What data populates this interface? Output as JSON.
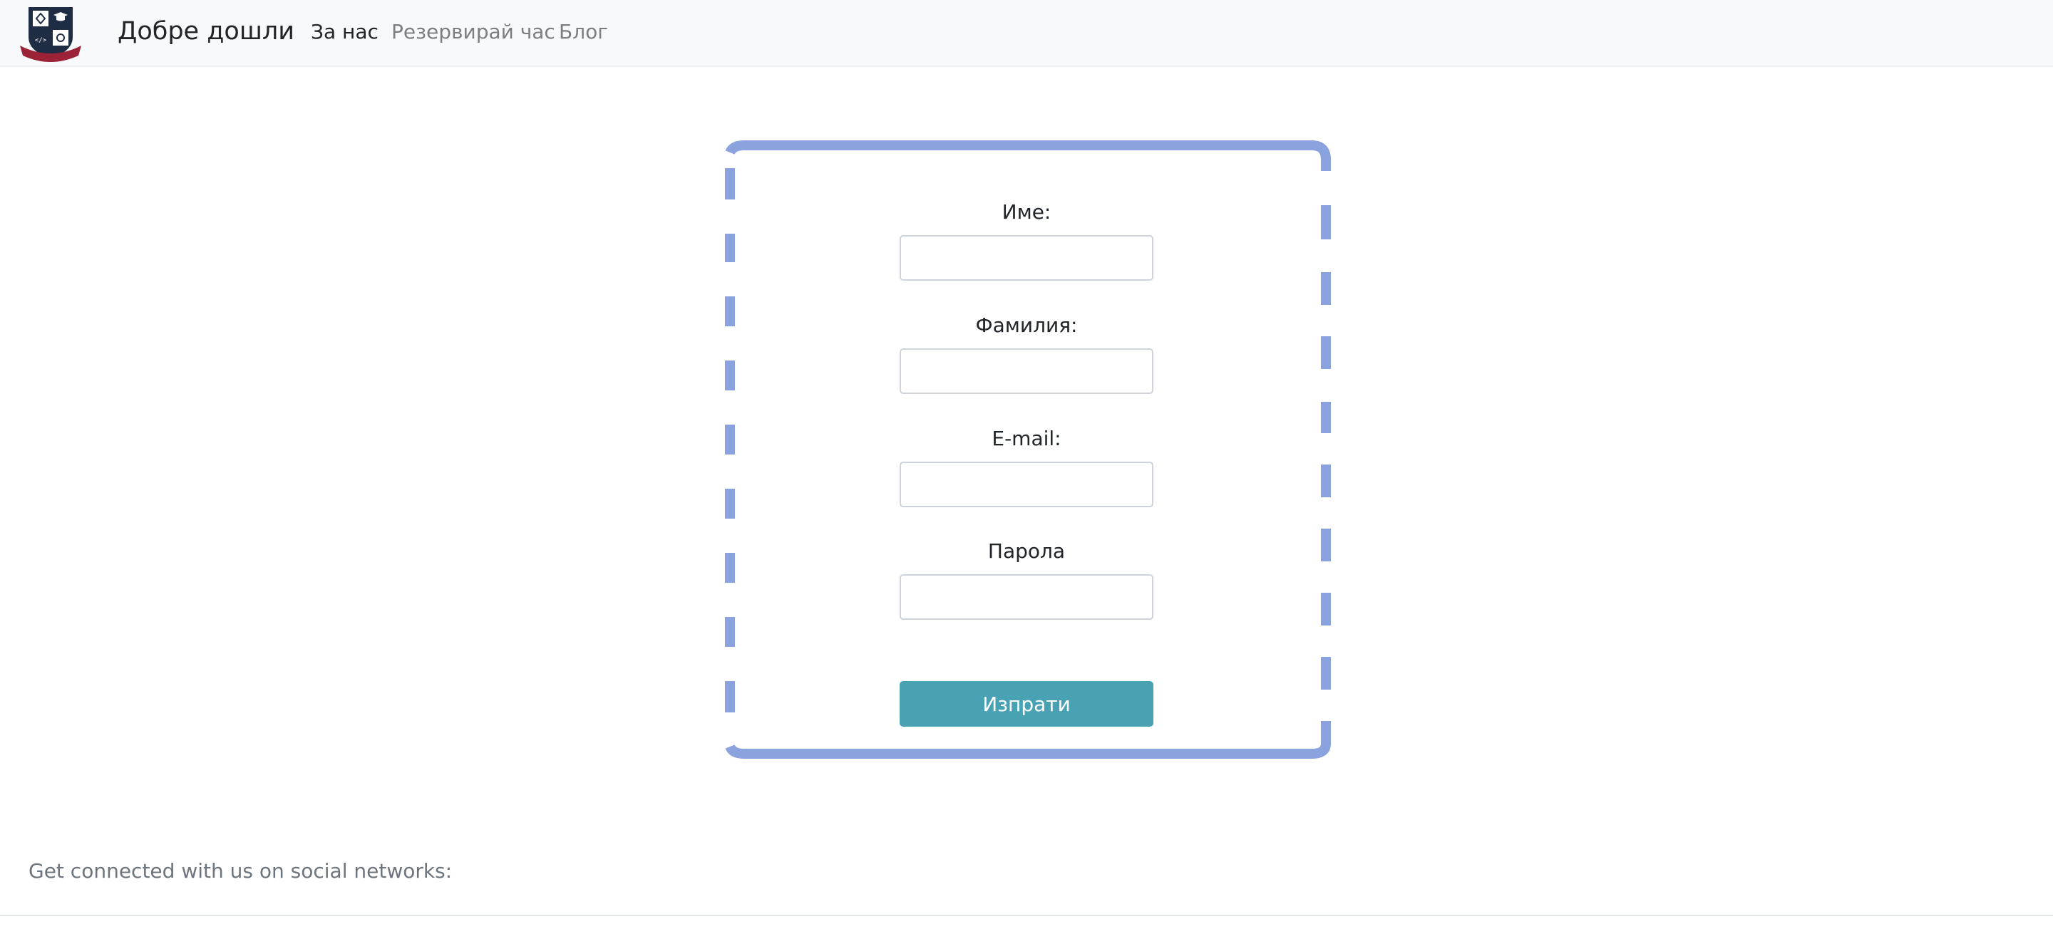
{
  "navbar": {
    "logo": "school-crest-logo",
    "brand": "Добре дошли",
    "links": [
      {
        "label": "За нас",
        "active": true
      },
      {
        "label": "Резервирай час",
        "active": false
      },
      {
        "label": "Блог",
        "active": false
      }
    ]
  },
  "form": {
    "fields": [
      {
        "label": "Име:",
        "value": ""
      },
      {
        "label": "Фамилия:",
        "value": ""
      },
      {
        "label": "E-mail:",
        "value": ""
      },
      {
        "label": "Парола",
        "value": ""
      }
    ],
    "submit_label": "Изпрати",
    "frame_color": "#8aa2dd"
  },
  "footer": {
    "social_text": "Get connected with us on social networks:"
  },
  "colors": {
    "navbar_bg": "#f8f9fa",
    "button_bg": "#49a1b4",
    "logo_navy": "#1f2d44",
    "logo_red": "#9b2237"
  }
}
